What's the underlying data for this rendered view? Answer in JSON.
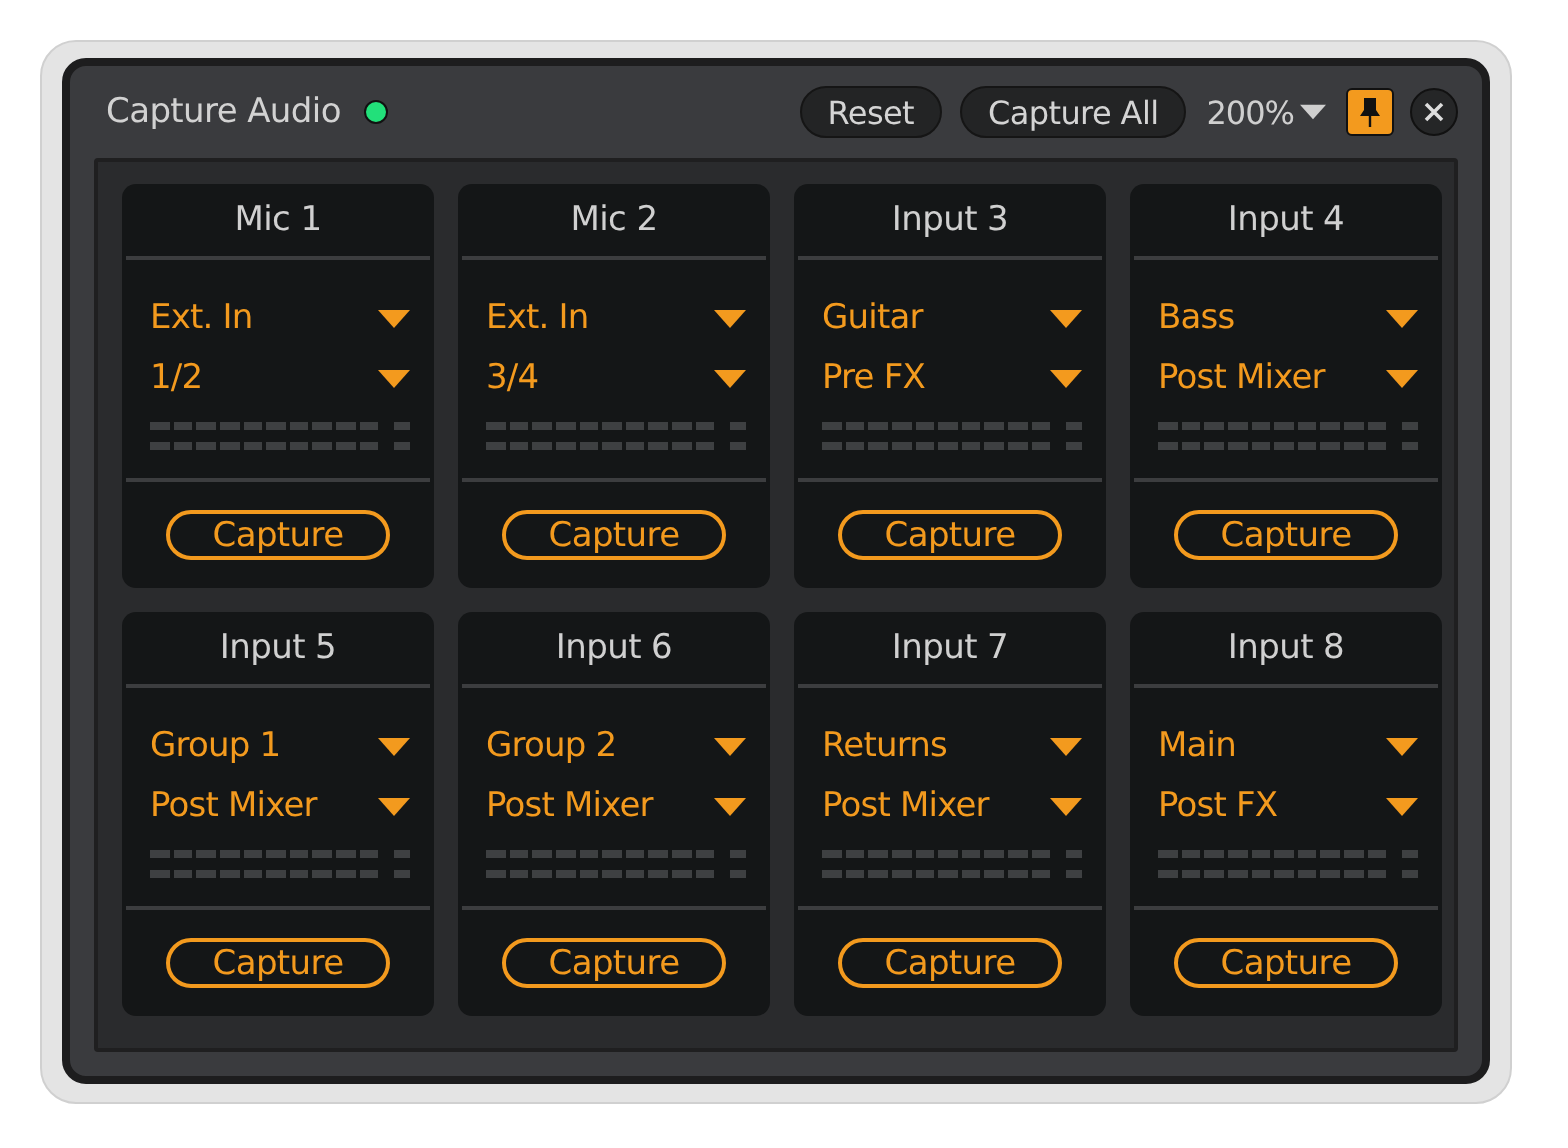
{
  "window": {
    "title": "Capture Audio",
    "indicator_on": true
  },
  "toolbar": {
    "buttons": [
      "Reset",
      "Capture All"
    ],
    "zoom": "200%",
    "pinned": true
  },
  "channels": [
    {
      "name": "Mic 1",
      "source": "Ext. In",
      "tap": "1/2",
      "button": "Capture"
    },
    {
      "name": "Mic 2",
      "source": "Ext. In",
      "tap": "3/4",
      "button": "Capture"
    },
    {
      "name": "Input 3",
      "source": "Guitar",
      "tap": "Pre FX",
      "button": "Capture"
    },
    {
      "name": "Input 4",
      "source": "Bass",
      "tap": "Post Mixer",
      "button": "Capture"
    },
    {
      "name": "Input 5",
      "source": "Group 1",
      "tap": "Post Mixer",
      "button": "Capture"
    },
    {
      "name": "Input 6",
      "source": "Group 2",
      "tap": "Post Mixer",
      "button": "Capture"
    },
    {
      "name": "Input 7",
      "source": "Returns",
      "tap": "Post Mixer",
      "button": "Capture"
    },
    {
      "name": "Input 8",
      "source": "Main",
      "tap": "Post FX",
      "button": "Capture"
    }
  ]
}
